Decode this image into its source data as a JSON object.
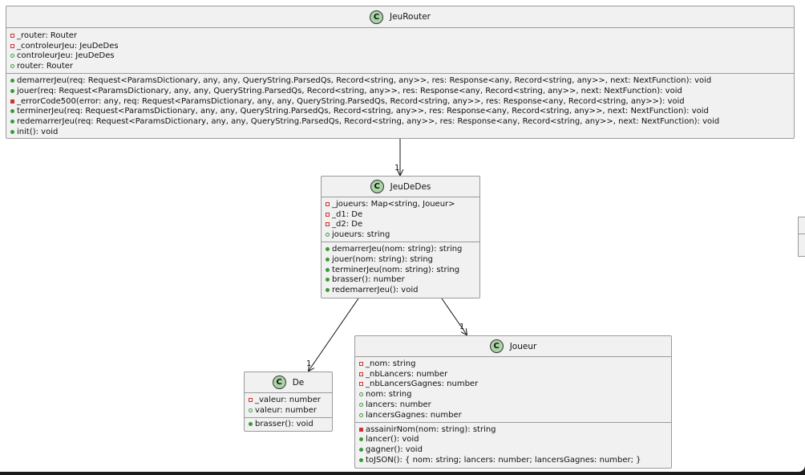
{
  "classes": {
    "jeurouter": {
      "name": "JeuRouter",
      "attributes": [
        {
          "vis": "priv-attr",
          "text": "_router: Router"
        },
        {
          "vis": "priv-attr",
          "text": "_controleurJeu: JeuDeDes"
        },
        {
          "vis": "pub-attr",
          "text": "controleurJeu: JeuDeDes"
        },
        {
          "vis": "pub-attr",
          "text": "router: Router"
        }
      ],
      "operations": [
        {
          "vis": "pub-op",
          "text": "demarrerJeu(req: Request<ParamsDictionary, any, any, QueryString.ParsedQs, Record<string, any>>, res: Response<any, Record<string, any>>, next: NextFunction): void"
        },
        {
          "vis": "pub-op",
          "text": "jouer(req: Request<ParamsDictionary, any, any, QueryString.ParsedQs, Record<string, any>>, res: Response<any, Record<string, any>>, next: NextFunction): void"
        },
        {
          "vis": "priv-op",
          "text": "_errorCode500(error: any, req: Request<ParamsDictionary, any, any, QueryString.ParsedQs, Record<string, any>>, res: Response<any, Record<string, any>>): void"
        },
        {
          "vis": "pub-op",
          "text": "terminerJeu(req: Request<ParamsDictionary, any, any, QueryString.ParsedQs, Record<string, any>>, res: Response<any, Record<string, any>>, next: NextFunction): void"
        },
        {
          "vis": "pub-op",
          "text": "redemarrerJeu(req: Request<ParamsDictionary, any, any, QueryString.ParsedQs, Record<string, any>>, res: Response<any, Record<string, any>>, next: NextFunction): void"
        },
        {
          "vis": "pub-op",
          "text": "init(): void"
        }
      ]
    },
    "jeudedes": {
      "name": "JeuDeDes",
      "attributes": [
        {
          "vis": "priv-attr",
          "text": "_joueurs: Map<string, Joueur>"
        },
        {
          "vis": "priv-attr",
          "text": "_d1: De"
        },
        {
          "vis": "priv-attr",
          "text": "_d2: De"
        },
        {
          "vis": "pub-attr",
          "text": "joueurs: string"
        }
      ],
      "operations": [
        {
          "vis": "pub-op",
          "text": "demarrerJeu(nom: string): string"
        },
        {
          "vis": "pub-op",
          "text": "jouer(nom: string): string"
        },
        {
          "vis": "pub-op",
          "text": "terminerJeu(nom: string): string"
        },
        {
          "vis": "pub-op",
          "text": "brasser(): number"
        },
        {
          "vis": "pub-op",
          "text": "redemarrerJeu(): void"
        }
      ]
    },
    "de": {
      "name": "De",
      "attributes": [
        {
          "vis": "priv-attr",
          "text": "_valeur: number"
        },
        {
          "vis": "pub-attr",
          "text": "valeur: number"
        }
      ],
      "operations": [
        {
          "vis": "pub-op",
          "text": "brasser(): void"
        }
      ]
    },
    "joueur": {
      "name": "Joueur",
      "attributes": [
        {
          "vis": "priv-attr",
          "text": "_nom: string"
        },
        {
          "vis": "priv-attr",
          "text": "_nbLancers: number"
        },
        {
          "vis": "priv-attr",
          "text": "_nbLancersGagnes: number"
        },
        {
          "vis": "pub-attr",
          "text": "nom: string"
        },
        {
          "vis": "pub-attr",
          "text": "lancers: number"
        },
        {
          "vis": "pub-attr",
          "text": "lancersGagnes: number"
        }
      ],
      "operations": [
        {
          "vis": "priv-op",
          "text": "assainirNom(nom: string): string"
        },
        {
          "vis": "pub-op",
          "text": "lancer(): void"
        },
        {
          "vis": "pub-op",
          "text": "gagner(): void"
        },
        {
          "vis": "pub-op",
          "text": "toJSON(): { nom: string; lancers: number; lancersGagnes: number; }"
        }
      ]
    }
  },
  "badge_letter": "C",
  "links": [
    {
      "from": "JeuRouter",
      "to": "JeuDeDes",
      "multiplicity": "1"
    },
    {
      "from": "JeuDeDes",
      "to": "De",
      "multiplicity": "1"
    },
    {
      "from": "JeuDeDes",
      "to": "Joueur",
      "multiplicity": "1"
    }
  ],
  "colors": {
    "badge_fill": "#a9d4a5",
    "public_marker": "#3a9a3a",
    "private_marker": "#cc3333",
    "class_fill": "#f1f1f1",
    "border": "#9a9a9a"
  }
}
